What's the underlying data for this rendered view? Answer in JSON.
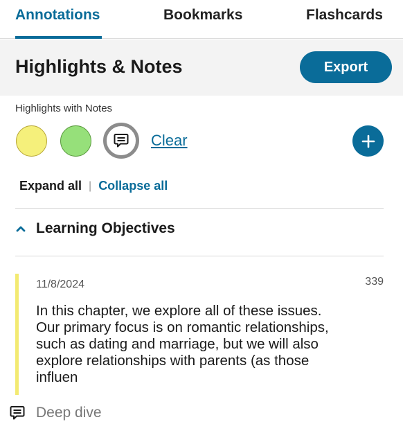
{
  "tabs": [
    {
      "label": "Annotations",
      "active": true
    },
    {
      "label": "Bookmarks",
      "active": false
    },
    {
      "label": "Flashcards",
      "active": false
    }
  ],
  "header": {
    "title": "Highlights & Notes",
    "export_label": "Export"
  },
  "filters": {
    "label": "Highlights with Notes",
    "swatches": [
      {
        "name": "yellow",
        "color": "#f5f07b"
      },
      {
        "name": "green",
        "color": "#96e07a"
      },
      {
        "name": "notes",
        "icon": "comment-icon"
      }
    ],
    "clear_label": "Clear",
    "add_icon": "plus-icon"
  },
  "expand": {
    "expand_all": "Expand all",
    "separator": "|",
    "collapse_all": "Collapse all"
  },
  "section": {
    "title": "Learning Objectives",
    "icon": "chevron-up-icon"
  },
  "annotation": {
    "date": "11/8/2024",
    "page": "339",
    "highlight_color": "#f3ea72",
    "text": "In this chapter, we explore all of these issues. Our primary focus is on romantic relationships, such as dating and marriage, but we will also explore relationships with parents (as those influen",
    "note_icon": "comment-icon",
    "note": "Deep dive"
  },
  "colors": {
    "accent": "#0a6c99",
    "header_bg": "#f3f3f3"
  }
}
